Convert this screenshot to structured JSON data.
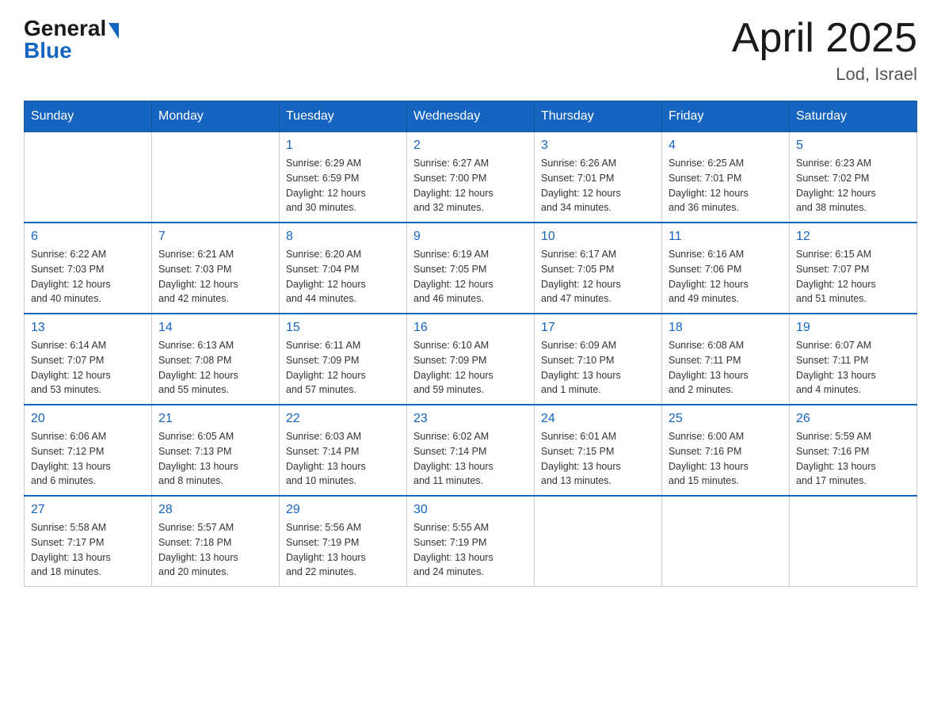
{
  "header": {
    "logo": {
      "general": "General",
      "blue": "Blue"
    },
    "title": "April 2025",
    "location": "Lod, Israel"
  },
  "calendar": {
    "days_of_week": [
      "Sunday",
      "Monday",
      "Tuesday",
      "Wednesday",
      "Thursday",
      "Friday",
      "Saturday"
    ],
    "weeks": [
      [
        {
          "day": "",
          "info": ""
        },
        {
          "day": "",
          "info": ""
        },
        {
          "day": "1",
          "info": "Sunrise: 6:29 AM\nSunset: 6:59 PM\nDaylight: 12 hours\nand 30 minutes."
        },
        {
          "day": "2",
          "info": "Sunrise: 6:27 AM\nSunset: 7:00 PM\nDaylight: 12 hours\nand 32 minutes."
        },
        {
          "day": "3",
          "info": "Sunrise: 6:26 AM\nSunset: 7:01 PM\nDaylight: 12 hours\nand 34 minutes."
        },
        {
          "day": "4",
          "info": "Sunrise: 6:25 AM\nSunset: 7:01 PM\nDaylight: 12 hours\nand 36 minutes."
        },
        {
          "day": "5",
          "info": "Sunrise: 6:23 AM\nSunset: 7:02 PM\nDaylight: 12 hours\nand 38 minutes."
        }
      ],
      [
        {
          "day": "6",
          "info": "Sunrise: 6:22 AM\nSunset: 7:03 PM\nDaylight: 12 hours\nand 40 minutes."
        },
        {
          "day": "7",
          "info": "Sunrise: 6:21 AM\nSunset: 7:03 PM\nDaylight: 12 hours\nand 42 minutes."
        },
        {
          "day": "8",
          "info": "Sunrise: 6:20 AM\nSunset: 7:04 PM\nDaylight: 12 hours\nand 44 minutes."
        },
        {
          "day": "9",
          "info": "Sunrise: 6:19 AM\nSunset: 7:05 PM\nDaylight: 12 hours\nand 46 minutes."
        },
        {
          "day": "10",
          "info": "Sunrise: 6:17 AM\nSunset: 7:05 PM\nDaylight: 12 hours\nand 47 minutes."
        },
        {
          "day": "11",
          "info": "Sunrise: 6:16 AM\nSunset: 7:06 PM\nDaylight: 12 hours\nand 49 minutes."
        },
        {
          "day": "12",
          "info": "Sunrise: 6:15 AM\nSunset: 7:07 PM\nDaylight: 12 hours\nand 51 minutes."
        }
      ],
      [
        {
          "day": "13",
          "info": "Sunrise: 6:14 AM\nSunset: 7:07 PM\nDaylight: 12 hours\nand 53 minutes."
        },
        {
          "day": "14",
          "info": "Sunrise: 6:13 AM\nSunset: 7:08 PM\nDaylight: 12 hours\nand 55 minutes."
        },
        {
          "day": "15",
          "info": "Sunrise: 6:11 AM\nSunset: 7:09 PM\nDaylight: 12 hours\nand 57 minutes."
        },
        {
          "day": "16",
          "info": "Sunrise: 6:10 AM\nSunset: 7:09 PM\nDaylight: 12 hours\nand 59 minutes."
        },
        {
          "day": "17",
          "info": "Sunrise: 6:09 AM\nSunset: 7:10 PM\nDaylight: 13 hours\nand 1 minute."
        },
        {
          "day": "18",
          "info": "Sunrise: 6:08 AM\nSunset: 7:11 PM\nDaylight: 13 hours\nand 2 minutes."
        },
        {
          "day": "19",
          "info": "Sunrise: 6:07 AM\nSunset: 7:11 PM\nDaylight: 13 hours\nand 4 minutes."
        }
      ],
      [
        {
          "day": "20",
          "info": "Sunrise: 6:06 AM\nSunset: 7:12 PM\nDaylight: 13 hours\nand 6 minutes."
        },
        {
          "day": "21",
          "info": "Sunrise: 6:05 AM\nSunset: 7:13 PM\nDaylight: 13 hours\nand 8 minutes."
        },
        {
          "day": "22",
          "info": "Sunrise: 6:03 AM\nSunset: 7:14 PM\nDaylight: 13 hours\nand 10 minutes."
        },
        {
          "day": "23",
          "info": "Sunrise: 6:02 AM\nSunset: 7:14 PM\nDaylight: 13 hours\nand 11 minutes."
        },
        {
          "day": "24",
          "info": "Sunrise: 6:01 AM\nSunset: 7:15 PM\nDaylight: 13 hours\nand 13 minutes."
        },
        {
          "day": "25",
          "info": "Sunrise: 6:00 AM\nSunset: 7:16 PM\nDaylight: 13 hours\nand 15 minutes."
        },
        {
          "day": "26",
          "info": "Sunrise: 5:59 AM\nSunset: 7:16 PM\nDaylight: 13 hours\nand 17 minutes."
        }
      ],
      [
        {
          "day": "27",
          "info": "Sunrise: 5:58 AM\nSunset: 7:17 PM\nDaylight: 13 hours\nand 18 minutes."
        },
        {
          "day": "28",
          "info": "Sunrise: 5:57 AM\nSunset: 7:18 PM\nDaylight: 13 hours\nand 20 minutes."
        },
        {
          "day": "29",
          "info": "Sunrise: 5:56 AM\nSunset: 7:19 PM\nDaylight: 13 hours\nand 22 minutes."
        },
        {
          "day": "30",
          "info": "Sunrise: 5:55 AM\nSunset: 7:19 PM\nDaylight: 13 hours\nand 24 minutes."
        },
        {
          "day": "",
          "info": ""
        },
        {
          "day": "",
          "info": ""
        },
        {
          "day": "",
          "info": ""
        }
      ]
    ]
  }
}
